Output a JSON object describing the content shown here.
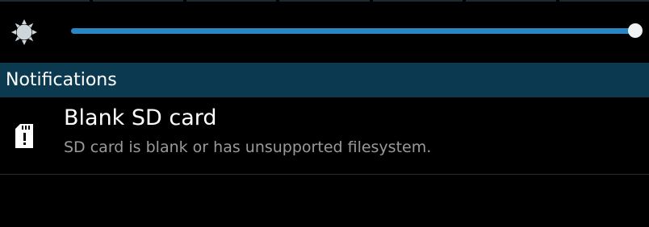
{
  "brightness": {
    "icon": "brightness-sun-icon",
    "level_fraction": 0.99,
    "colors": {
      "fill": "#2a86c2",
      "track": "#1b3a4a",
      "thumb": "#eef2f4"
    }
  },
  "notifications": {
    "header_label": "Notifications",
    "header_color": "#0b3a50",
    "items": [
      {
        "icon": "sd-card-warning-icon",
        "title": "Blank SD card",
        "subtitle": "SD card is blank or has unsupported filesystem."
      }
    ]
  }
}
